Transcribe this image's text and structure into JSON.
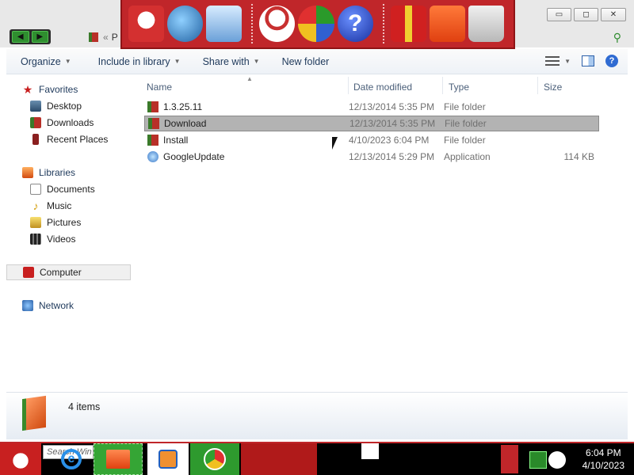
{
  "window": {
    "minimize_glyph": "▭",
    "maximize_glyph": "◻",
    "close_glyph": "✕"
  },
  "nav": {
    "back_glyph": "◀",
    "forward_glyph": "▶",
    "address_sep": "«",
    "address_crumb": "P"
  },
  "dock": {
    "icons": [
      "santa-computer-icon",
      "globe-icon",
      "control-panel-icon",
      "snowman-icon",
      "pie-icon",
      "help-icon",
      "gift-icon",
      "folder-icon",
      "recycle-bin-icon"
    ],
    "help_glyph": "?"
  },
  "toolbar": {
    "organize": "Organize",
    "include_in_library": "Include in library",
    "share_with": "Share with",
    "new_folder": "New folder",
    "caret": "▼",
    "help_glyph": "?"
  },
  "sidebar": {
    "favorites": "Favorites",
    "desktop": "Desktop",
    "downloads": "Downloads",
    "recent_places": "Recent Places",
    "libraries": "Libraries",
    "documents": "Documents",
    "music": "Music",
    "pictures": "Pictures",
    "videos": "Videos",
    "computer": "Computer",
    "network": "Network",
    "star_glyph": "★",
    "note_glyph": "♪"
  },
  "columns": {
    "name": "Name",
    "date_modified": "Date modified",
    "type": "Type",
    "size": "Size",
    "sort_glyph": "▲"
  },
  "files": [
    {
      "name": "1.3.25.11",
      "date": "12/13/2014 5:35 PM",
      "type": "File folder",
      "size": ""
    },
    {
      "name": "Download",
      "date": "12/13/2014 5:35 PM",
      "type": "File folder",
      "size": ""
    },
    {
      "name": "Install",
      "date": "4/10/2023 6:04 PM",
      "type": "File folder",
      "size": ""
    },
    {
      "name": "GoogleUpdate",
      "date": "12/13/2014 5:29 PM",
      "type": "Application",
      "size": "114 KB"
    }
  ],
  "details": {
    "item_count": "4 items"
  },
  "taskbar": {
    "search_placeholder": "Search Win",
    "ie_glyph": "e",
    "clock_time": "6:04 PM",
    "clock_date": "4/10/2023"
  }
}
